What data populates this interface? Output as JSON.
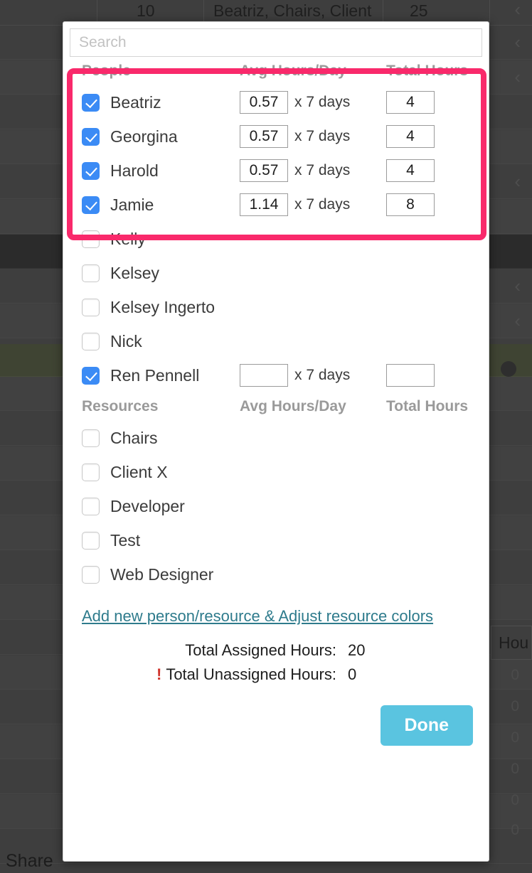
{
  "background": {
    "top_row": {
      "count": "10",
      "assignees": "Beatriz, Chairs, Client",
      "value": "25"
    },
    "hours_column_header": "Hou",
    "hour_values": [
      "0",
      "0",
      "0",
      "0",
      "0",
      "0"
    ],
    "share_label": "Share",
    "chevron": "‹"
  },
  "modal": {
    "search": {
      "placeholder": "Search",
      "value": ""
    },
    "people_section": {
      "headers": {
        "name": "People",
        "avg": "Avg Hours/Day",
        "total": "Total Hours"
      },
      "rows": [
        {
          "name": "Beatriz",
          "checked": true,
          "avg": "0.57",
          "days_label": "x 7 days",
          "total": "4",
          "highlighted": true
        },
        {
          "name": "Georgina",
          "checked": true,
          "avg": "0.57",
          "days_label": "x 7 days",
          "total": "4",
          "highlighted": true
        },
        {
          "name": "Harold",
          "checked": true,
          "avg": "0.57",
          "days_label": "x 7 days",
          "total": "4",
          "highlighted": true
        },
        {
          "name": "Jamie",
          "checked": true,
          "avg": "1.14",
          "days_label": "x 7 days",
          "total": "8",
          "highlighted": true
        },
        {
          "name": "Kelly",
          "checked": false,
          "avg": "",
          "days_label": "",
          "total": "",
          "highlighted": false
        },
        {
          "name": "Kelsey",
          "checked": false,
          "avg": "",
          "days_label": "",
          "total": "",
          "highlighted": false
        },
        {
          "name": "Kelsey Ingerto",
          "checked": false,
          "avg": "",
          "days_label": "",
          "total": "",
          "highlighted": false
        },
        {
          "name": "Nick",
          "checked": false,
          "avg": "",
          "days_label": "",
          "total": "",
          "highlighted": false
        },
        {
          "name": "Ren Pennell",
          "checked": true,
          "avg": "",
          "days_label": "x 7 days",
          "total": "",
          "highlighted": false
        }
      ]
    },
    "resources_section": {
      "headers": {
        "name": "Resources",
        "avg": "Avg Hours/Day",
        "total": "Total Hours"
      },
      "rows": [
        {
          "name": "Chairs",
          "checked": false
        },
        {
          "name": "Client X",
          "checked": false
        },
        {
          "name": "Developer",
          "checked": false
        },
        {
          "name": "Test",
          "checked": false
        },
        {
          "name": "Web Designer",
          "checked": false
        }
      ]
    },
    "add_link": "Add new person/resource & Adjust resource colors",
    "totals": {
      "assigned_label": "Total Assigned Hours:",
      "assigned_value": "20",
      "unassigned_bang": "!",
      "unassigned_label": "Total Unassigned Hours:",
      "unassigned_value": "0"
    },
    "done_label": "Done"
  },
  "colors": {
    "highlight_pink": "#f9296b",
    "checkbox_blue": "#3b8bf5",
    "done_blue": "#5ac4e0",
    "link_teal": "#2e7b8c",
    "alert_red": "#d0342c"
  }
}
